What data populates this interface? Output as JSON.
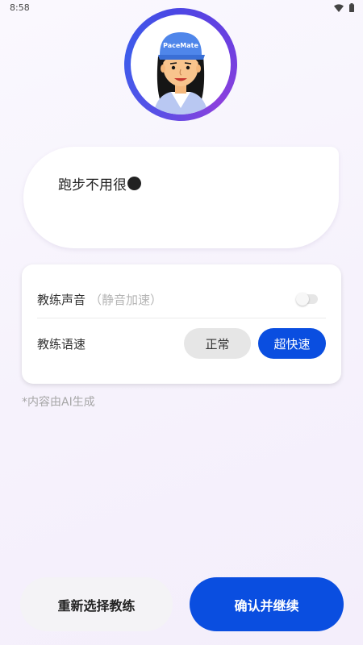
{
  "status_bar": {
    "time": "8:58",
    "icons": [
      "wifi-icon",
      "battery-icon"
    ]
  },
  "avatar": {
    "cap_text": "PaceMate",
    "ring_colors": [
      "#4a47e4",
      "#8b40dd",
      "#3e5ceb"
    ]
  },
  "speech": {
    "text": "跑步不用很"
  },
  "settings": {
    "voice_label": "教练声音",
    "voice_hint": "（静音加速）",
    "voice_toggle_on": false,
    "speed_label": "教练语速",
    "speed_options": [
      "正常",
      "超快速"
    ],
    "speed_selected": "超快速"
  },
  "ai_note": "*内容由AI生成",
  "buttons": {
    "reselect_label": "重新选择教练",
    "confirm_label": "确认并继续"
  },
  "colors": {
    "accent": "#0a4ee0",
    "neutral_button": "#e6e6e6",
    "background": "#f6f2fc"
  }
}
